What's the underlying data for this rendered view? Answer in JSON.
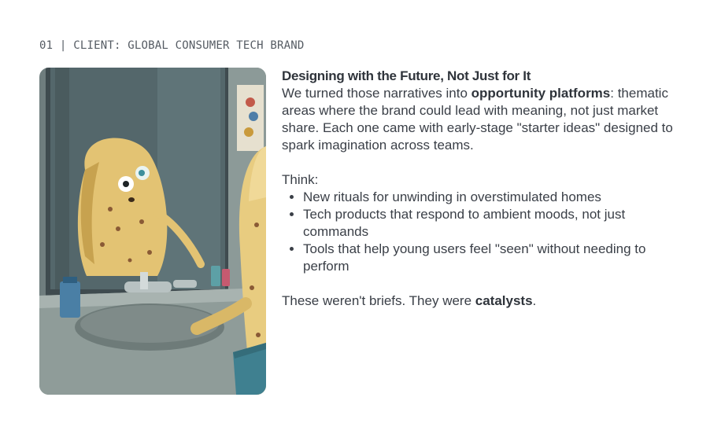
{
  "eyebrow": {
    "number": "01",
    "separator": "|",
    "client": "CLIENT: GLOBAL CONSUMER TECH BRAND"
  },
  "illustration": {
    "icon": "potato-mirror-illustration"
  },
  "content": {
    "heading": "Designing with the Future, Not Just for It",
    "intro_before": "We turned those narratives into ",
    "intro_bold": "opportunity platforms",
    "intro_after": ": thematic areas where the brand could lead with meaning, not just market share. Each one came with early-stage \"starter ideas\" designed to spark imagination across teams.",
    "think_label": "Think:",
    "bullets": [
      "New rituals for unwinding in overstimulated homes",
      "Tech products that respond to ambient moods, not just commands",
      "Tools that help young users feel \"seen\" without needing to perform"
    ],
    "closing_before": "These weren't briefs. They were ",
    "closing_bold": "catalysts",
    "closing_after": "."
  }
}
